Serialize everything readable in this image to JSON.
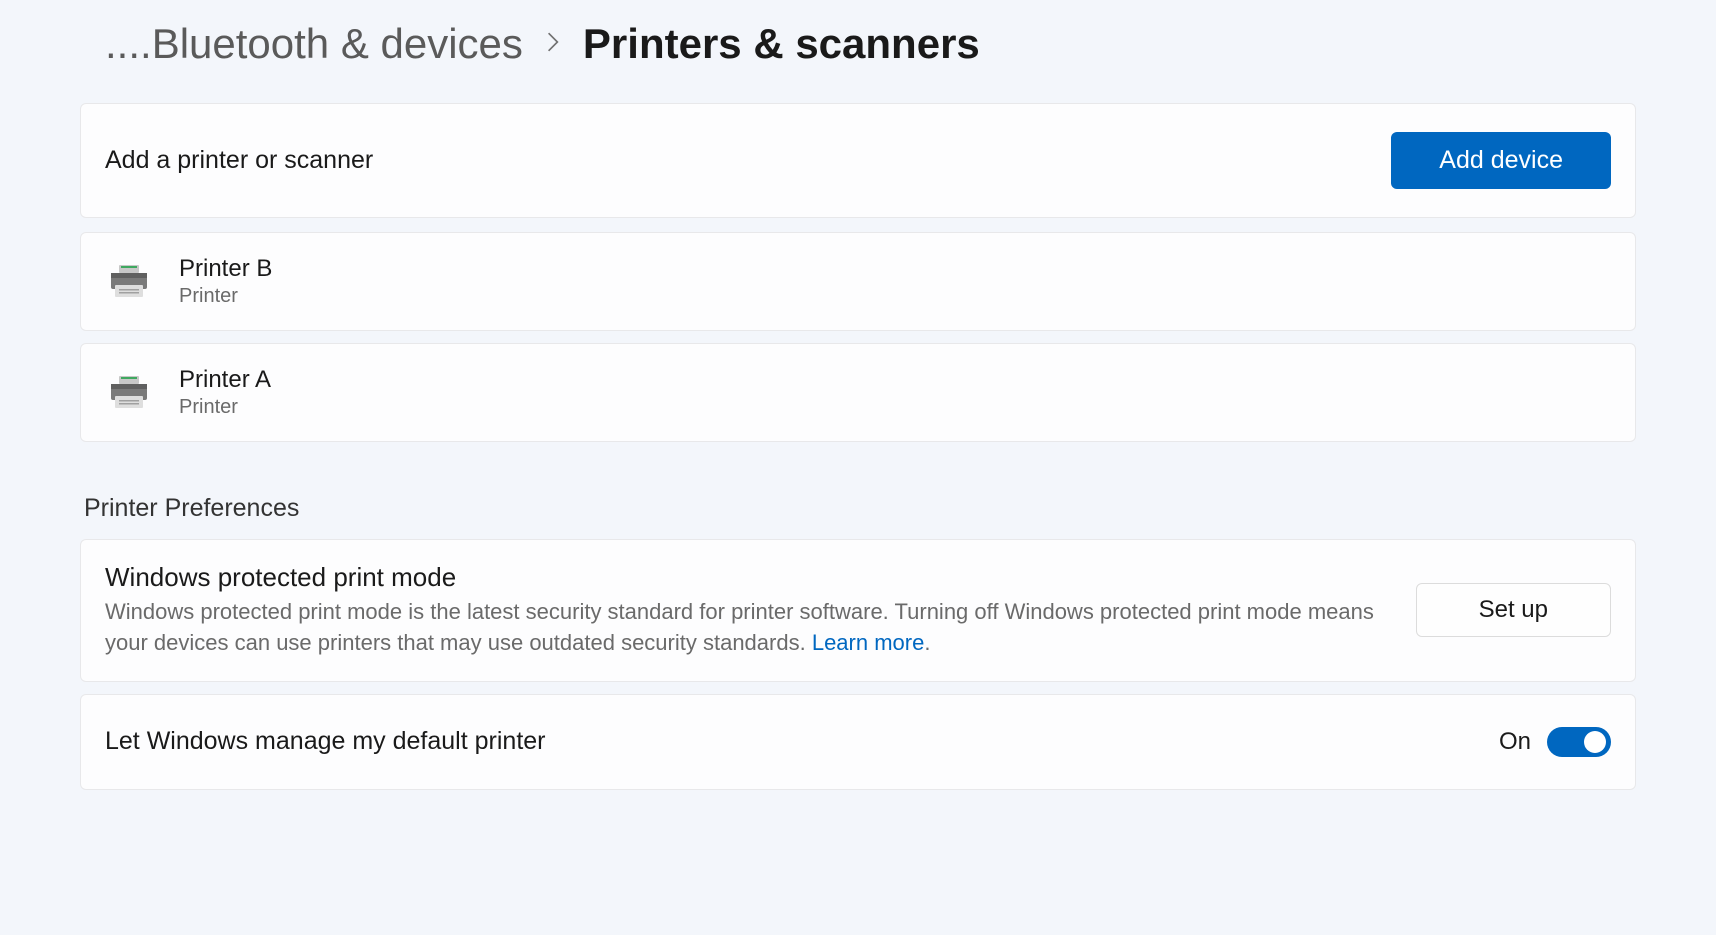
{
  "breadcrumb": {
    "prefix": "....",
    "parent": "Bluetooth & devices",
    "current": "Printers & scanners"
  },
  "add_section": {
    "label": "Add a printer or scanner",
    "button": "Add device"
  },
  "devices": [
    {
      "name": "Printer B",
      "type": "Printer"
    },
    {
      "name": "Printer A",
      "type": "Printer"
    }
  ],
  "preferences": {
    "header": "Printer Preferences",
    "protected": {
      "title": "Windows protected print mode",
      "desc_part1": "Windows protected print mode is the latest security standard for printer software. Turning off Windows protected print mode means your devices can use printers that may use outdated security standards. ",
      "learn_more": "Learn more",
      "desc_suffix": ".",
      "button": "Set up"
    },
    "default_printer": {
      "label": "Let Windows manage my default printer",
      "state": "On"
    }
  }
}
